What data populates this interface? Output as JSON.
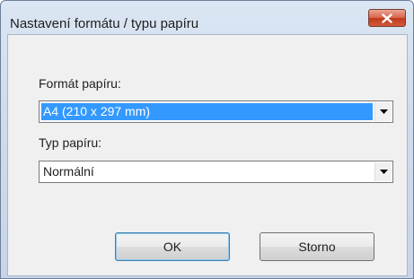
{
  "window": {
    "title": "Nastavení formátu / typu papíru",
    "close_icon": "close-icon"
  },
  "paper_format": {
    "label": "Formát papíru:",
    "value": "A4 (210 x 297 mm)"
  },
  "paper_type": {
    "label": "Typ papíru:",
    "value": "Normální"
  },
  "buttons": {
    "ok": "OK",
    "cancel": "Storno"
  },
  "colors": {
    "selection": "#3399ff",
    "close_button": "#c7442a",
    "dialog_background": "#f0f0f0"
  }
}
